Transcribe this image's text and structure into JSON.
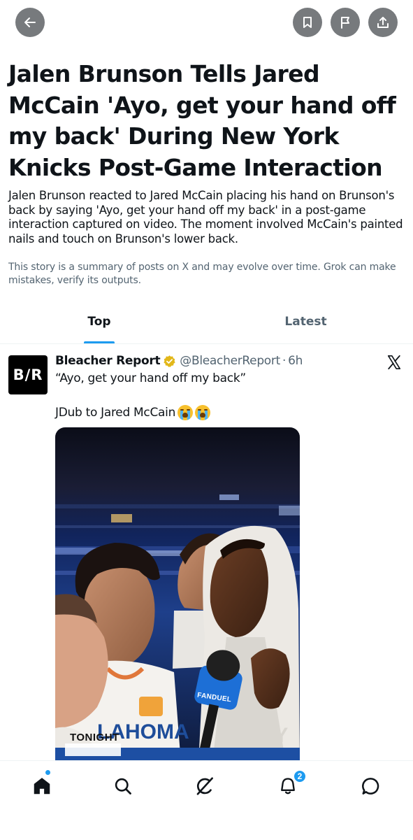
{
  "header": {
    "back_icon": "arrow-left-icon",
    "actions": [
      "bookmark-icon",
      "flag-icon",
      "share-icon"
    ]
  },
  "story": {
    "title": "Jalen Brunson Tells Jared McCain 'Ayo, get your hand off my back' During New York Knicks Post-Game Interaction",
    "summary": "Jalen Brunson reacted to Jared McCain placing his hand on Brunson's back by saying 'Ayo, get your hand off my back' in a post-game interaction captured on video. The moment involved McCain's painted nails and touch on Brunson's lower back.",
    "disclaimer": "This story is a summary of posts on X and may evolve over time. Grok can make mistakes, verify its outputs."
  },
  "tabs": [
    {
      "label": "Top",
      "active": true
    },
    {
      "label": "Latest",
      "active": false
    }
  ],
  "post": {
    "avatar_text": "B/R",
    "author_name": "Bleacher Report",
    "verified": true,
    "verified_color": "#e2b719",
    "handle": "@BleacherReport",
    "separator": "·",
    "time": "6h",
    "source_icon": "x-logo-icon",
    "text_line_1": "“Ayo, get your hand off my back”",
    "text_line_2": "JDub to Jared McCain",
    "emojis": [
      "loudly-crying-face-emoji",
      "loudly-crying-face-emoji"
    ],
    "media": {
      "type": "video-thumbnail",
      "overlay_label": "TONIGHT",
      "mic_flag_text": "FANDUEL"
    }
  },
  "bottom_nav": {
    "items": [
      "home-icon",
      "search-icon",
      "grok-icon",
      "notifications-icon",
      "messages-icon"
    ],
    "home_indicator": true,
    "notifications_count": "2",
    "accent_color": "#1d9bf0"
  }
}
